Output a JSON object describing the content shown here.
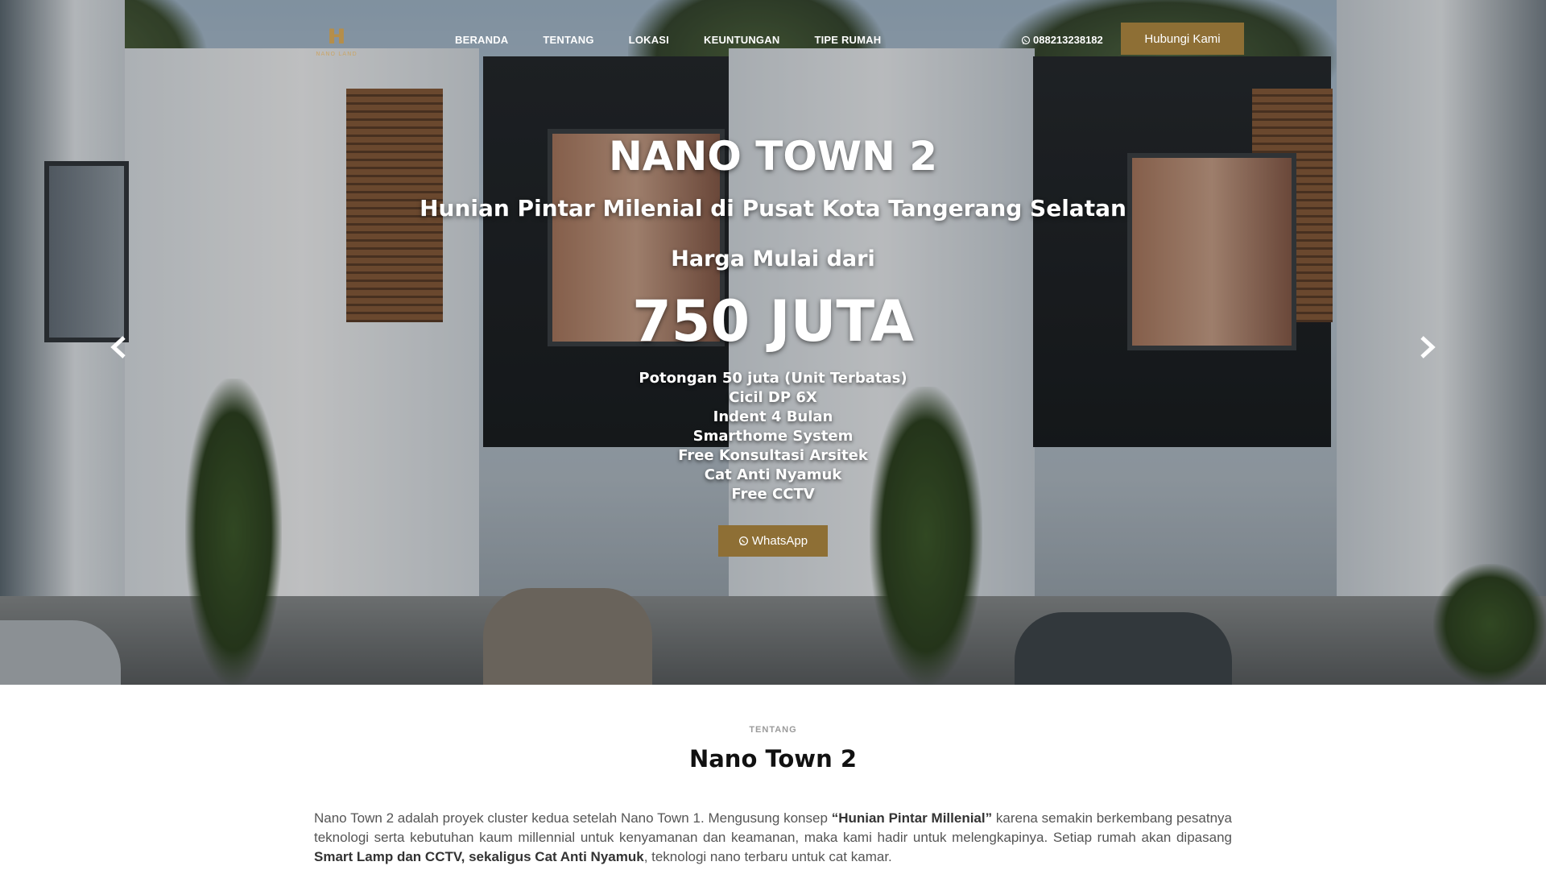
{
  "nav": {
    "logo_text": "NANO LAND",
    "items": [
      {
        "label": "BERANDA"
      },
      {
        "label": "TENTANG"
      },
      {
        "label": "LOKASI"
      },
      {
        "label": "KEUNTUNGAN"
      },
      {
        "label": "TIPE RUMAH"
      }
    ],
    "phone": "088213238182",
    "cta_label": "Hubungi Kami"
  },
  "hero": {
    "title": "NANO TOWN 2",
    "subtitle": "Hunian Pintar Milenial di Pusat Kota Tangerang Selatan",
    "price_label": "Harga Mulai dari",
    "price": "750 JUTA",
    "features": [
      "Potongan 50 juta (Unit Terbatas)",
      "Cicil DP 6X",
      "Indent 4 Bulan",
      "Smarthome System",
      "Free Konsultasi Arsitek",
      "Cat Anti Nyamuk",
      "Free CCTV"
    ],
    "whatsapp_label": "WhatsApp"
  },
  "about": {
    "kicker": "TENTANG",
    "title": "Nano Town 2",
    "p1": "Nano Town 2 adalah proyek cluster kedua setelah Nano Town 1. Mengusung konsep ",
    "b1": "“Hunian Pintar Millenial”",
    "p2": " karena semakin berkembang pesatnya teknologi serta kebutuhan kaum millennial untuk kenyamanan dan keamanan, maka kami hadir untuk melengkapinya. Setiap rumah akan dipasang ",
    "b2": "Smart Lamp dan CCTV, sekaligus Cat Anti Nyamuk",
    "p3": ", teknologi nano terbaru untuk cat kamar."
  },
  "colors": {
    "accent": "#8e6f35",
    "logo": "#b58e4a"
  }
}
